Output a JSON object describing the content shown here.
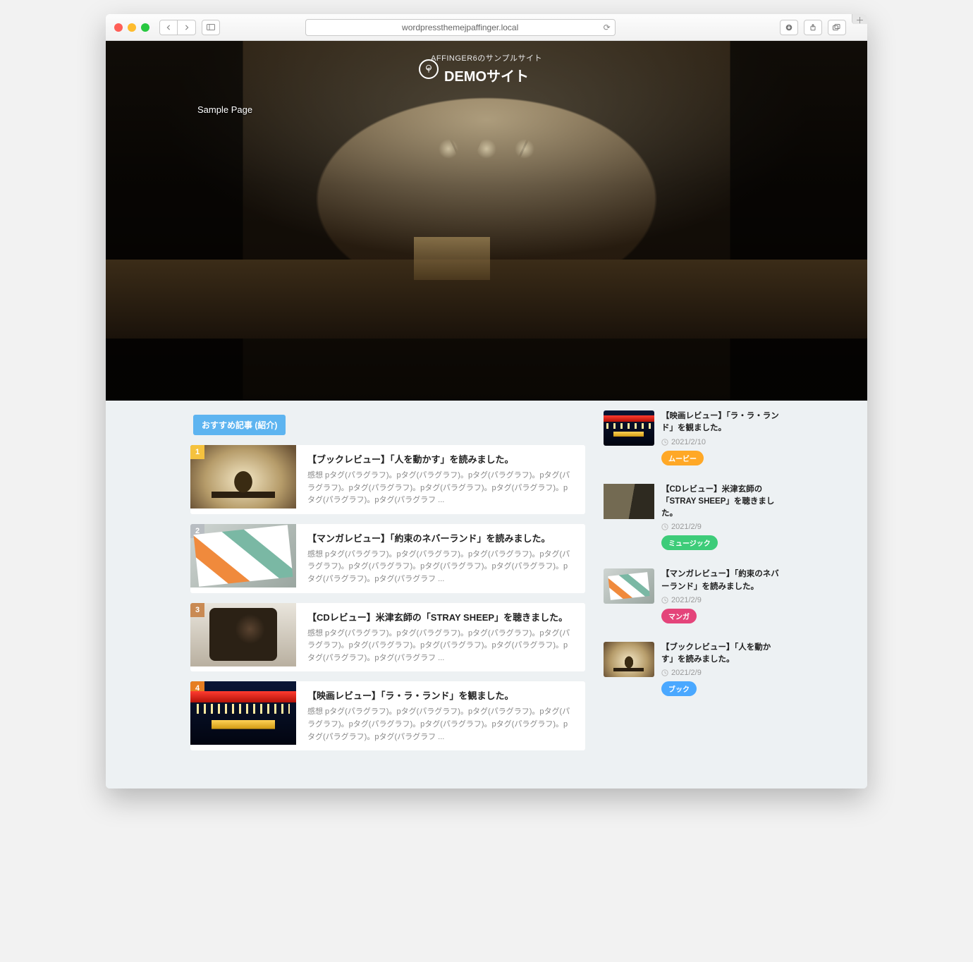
{
  "browser": {
    "url": "wordpressthemejpaffinger.local"
  },
  "hero": {
    "tagline": "AFFINGER6のサンプルサイト",
    "title": "DEMOサイト",
    "nav_link": "Sample Page"
  },
  "recommend_label": "おすすめ記事 (紹介)",
  "posts": [
    {
      "rank": "1",
      "title": "【ブックレビュー】「人を動かす」を読みました。",
      "excerpt": "感想 pタグ(パラグラフ)。pタグ(パラグラフ)。pタグ(パラグラフ)。pタグ(パラグラフ)。pタグ(パラグラフ)。pタグ(パラグラフ)。pタグ(パラグラフ)。pタグ(パラグラフ)。pタグ(パラグラフ ...",
      "thumb": "th-book"
    },
    {
      "rank": "2",
      "title": "【マンガレビュー】「約束のネバーランド」を読みました。",
      "excerpt": "感想 pタグ(パラグラフ)。pタグ(パラグラフ)。pタグ(パラグラフ)。pタグ(パラグラフ)。pタグ(パラグラフ)。pタグ(パラグラフ)。pタグ(パラグラフ)。pタグ(パラグラフ)。pタグ(パラグラフ ...",
      "thumb": "th-mag"
    },
    {
      "rank": "3",
      "title": "【CDレビュー】米津玄師の「STRAY SHEEP」を聴きました。",
      "excerpt": "感想 pタグ(パラグラフ)。pタグ(パラグラフ)。pタグ(パラグラフ)。pタグ(パラグラフ)。pタグ(パラグラフ)。pタグ(パラグラフ)。pタグ(パラグラフ)。pタグ(パラグラフ)。pタグ(パラグラフ ...",
      "thumb": "th-head"
    },
    {
      "rank": "4",
      "title": "【映画レビュー】「ラ・ラ・ランド」を観ました。",
      "excerpt": "感想 pタグ(パラグラフ)。pタグ(パラグラフ)。pタグ(パラグラフ)。pタグ(パラグラフ)。pタグ(パラグラフ)。pタグ(パラグラフ)。pタグ(パラグラフ)。pタグ(パラグラフ)。pタグ(パラグラフ ...",
      "thumb": "th-theatre"
    }
  ],
  "sidebar": [
    {
      "title": "【映画レビュー】「ラ・ラ・ランド」を観ました。",
      "date": "2021/2/10",
      "tag": "ムービー",
      "tag_class": "tag-movie",
      "thumb": "th-theatre"
    },
    {
      "title": "【CDレビュー】米津玄師の「STRAY SHEEP」を聴きました。",
      "date": "2021/2/9",
      "tag": "ミュージック",
      "tag_class": "tag-music",
      "thumb": "th-road"
    },
    {
      "title": "【マンガレビュー】「約束のネバーランド」を読みました。",
      "date": "2021/2/9",
      "tag": "マンガ",
      "tag_class": "tag-manga",
      "thumb": "th-mag"
    },
    {
      "title": "【ブックレビュー】「人を動かす」を読みました。",
      "date": "2021/2/9",
      "tag": "ブック",
      "tag_class": "tag-book",
      "thumb": "th-book"
    }
  ]
}
